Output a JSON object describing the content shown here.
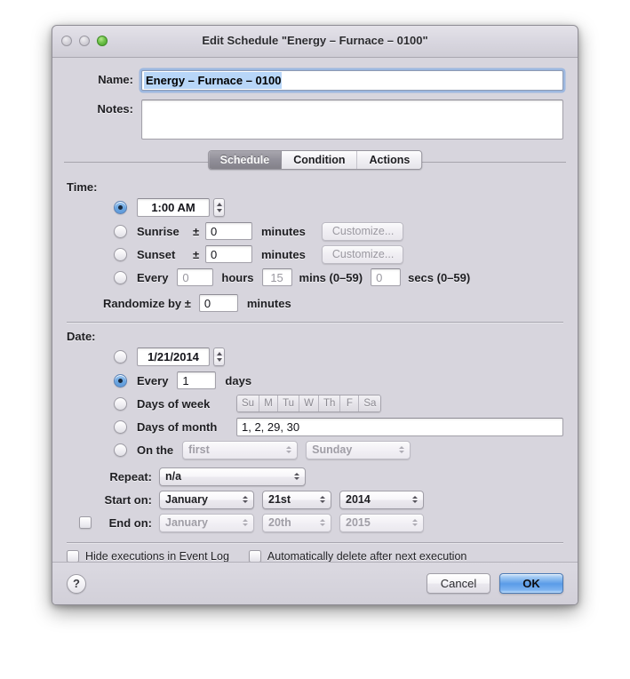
{
  "window": {
    "title": "Edit Schedule \"Energy – Furnace – 0100\"",
    "traffic_lights": [
      "close-button",
      "minimize-button",
      "zoom-button"
    ]
  },
  "header": {
    "name_label": "Name:",
    "name_value": "Energy – Furnace – 0100",
    "notes_label": "Notes:",
    "notes_value": "",
    "notes_placeholder": ""
  },
  "tabs": [
    {
      "label": "Schedule",
      "active": true
    },
    {
      "label": "Condition",
      "active": false
    },
    {
      "label": "Actions",
      "active": false
    }
  ],
  "time": {
    "section_label": "Time:",
    "time_of_day": {
      "selected": true,
      "value": "1:00 AM"
    },
    "sunrise": {
      "selected": false,
      "label": "Sunrise",
      "pm": "±",
      "offset": "0",
      "unit": "minutes",
      "button": "Customize..."
    },
    "sunset": {
      "selected": false,
      "label": "Sunset",
      "pm": "±",
      "offset": "0",
      "unit": "minutes",
      "button": "Customize..."
    },
    "every": {
      "selected": false,
      "label": "Every",
      "hours": "0",
      "hours_unit": "hours",
      "mins": "15",
      "mins_unit": "mins (0–59)",
      "secs": "0",
      "secs_unit": "secs (0–59)"
    },
    "randomize": {
      "label": "Randomize by ±",
      "value": "0",
      "unit": "minutes"
    }
  },
  "date": {
    "section_label": "Date:",
    "specific": {
      "selected": false,
      "value": "1/21/2014"
    },
    "every": {
      "selected": true,
      "label": "Every",
      "value": "1",
      "unit": "days"
    },
    "days_of_week": {
      "selected": false,
      "label": "Days of week",
      "days": [
        "Su",
        "M",
        "Tu",
        "W",
        "Th",
        "F",
        "Sa"
      ]
    },
    "days_of_month": {
      "selected": false,
      "label": "Days of month",
      "value": "1, 2, 29, 30"
    },
    "on_the": {
      "selected": false,
      "label": "On the",
      "ordinal": "first",
      "weekday": "Sunday"
    },
    "repeat": {
      "label": "Repeat:",
      "value": "n/a"
    },
    "start_on": {
      "label": "Start on:",
      "month": "January",
      "day": "21st",
      "year": "2014"
    },
    "end_on": {
      "checked": false,
      "label": "End on:",
      "month": "January",
      "day": "20th",
      "year": "2015"
    }
  },
  "options": {
    "hide_executions": {
      "checked": false,
      "label": "Hide executions in Event Log"
    },
    "auto_delete": {
      "checked": false,
      "label": "Automatically delete after next execution"
    }
  },
  "footer": {
    "help_label": "?",
    "cancel_label": "Cancel",
    "ok_label": "OK"
  },
  "colors": {
    "window_bg": "#d7d5dd",
    "accent_blue": "#5f9ada",
    "selection_blue": "#b8d6f8",
    "default_button_blue": "#5a9ce8",
    "zoom_green": "#6fc14a",
    "disabled_text": "#9a98a0"
  }
}
